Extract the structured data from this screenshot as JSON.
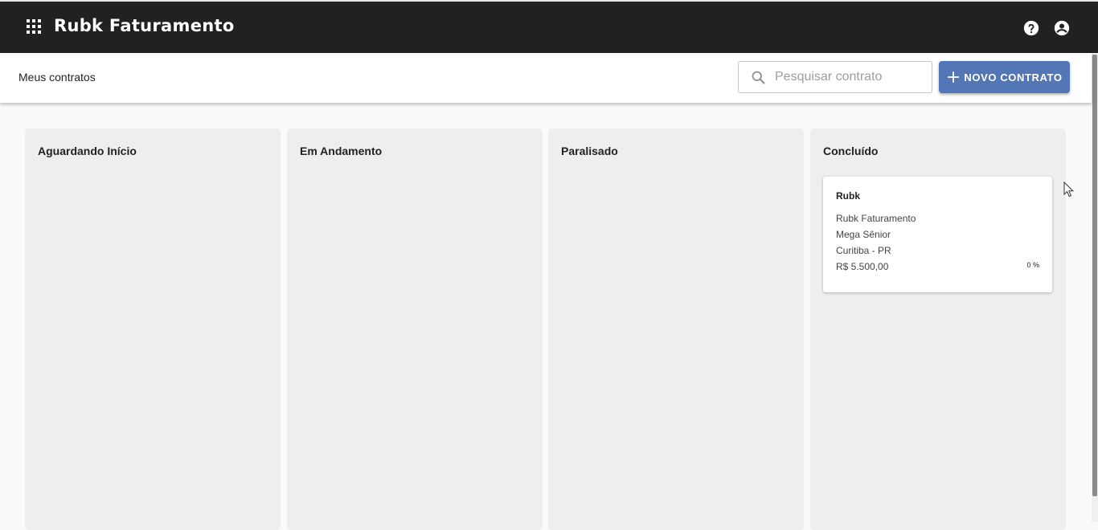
{
  "app": {
    "title": "Rubk Faturamento"
  },
  "header_icons": {
    "apps": "apps-grid-icon",
    "help": "help-circle-icon",
    "account": "account-circle-icon"
  },
  "toolbar": {
    "page_title": "Meus contratos",
    "search_placeholder": "Pesquisar contrato",
    "new_button_label": "NOVO CONTRATO"
  },
  "colors": {
    "appbar": "#212121",
    "accent": "#5376b7",
    "column_bg": "#eeeeee"
  },
  "columns": [
    {
      "title": "Aguardando Início",
      "cards": []
    },
    {
      "title": "Em Andamento",
      "cards": []
    },
    {
      "title": "Paralisado",
      "cards": []
    },
    {
      "title": "Concluído",
      "cards": [
        {
          "client": "Rubk",
          "project": "Rubk Faturamento",
          "system": "Mega Sênior",
          "location": "Curitiba - PR",
          "value": "R$ 5.500,00",
          "progress": "0 %"
        }
      ]
    }
  ]
}
